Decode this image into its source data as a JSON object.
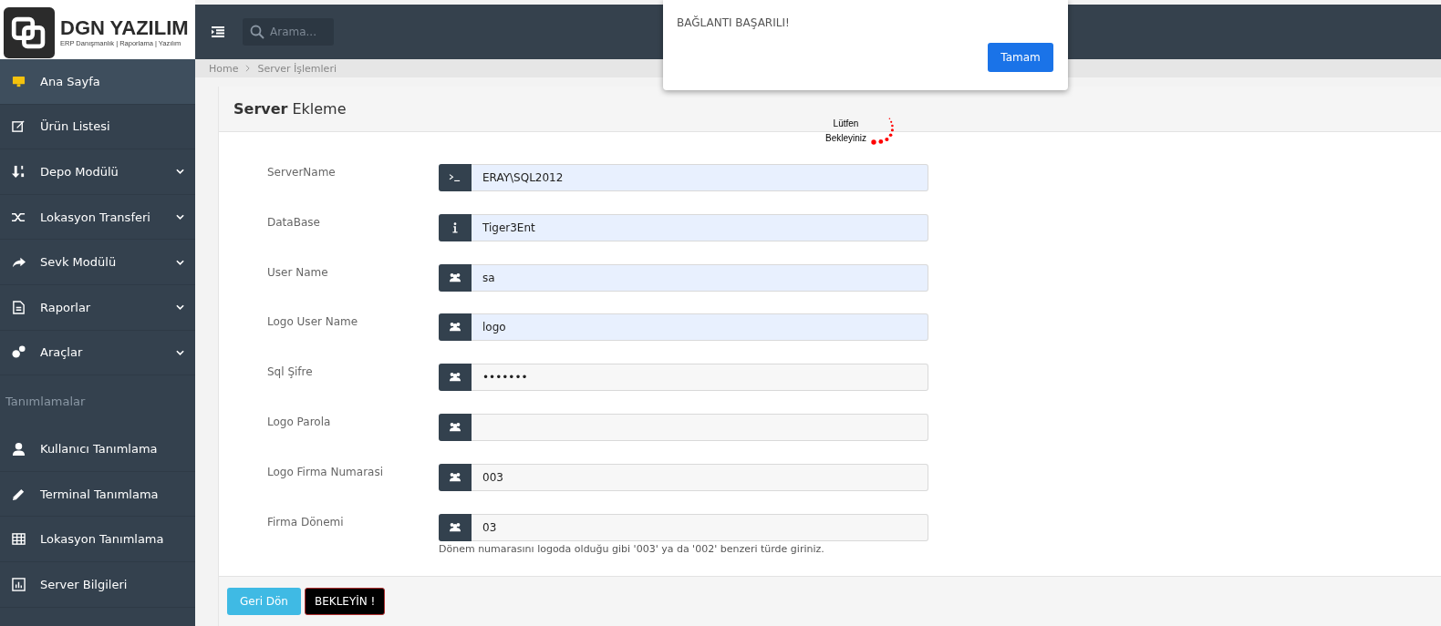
{
  "logo": {
    "title": "DGN YAZILIM",
    "subtitle": "ERP Danışmanlık | Raporlama | Yazılım"
  },
  "search": {
    "placeholder": "Arama..."
  },
  "breadcrumb": [
    "Home",
    "Server İşlemleri"
  ],
  "sidebar": {
    "items": [
      {
        "kind": "item",
        "label": "Ana Sayfa",
        "selected": true,
        "has_submenu": false
      },
      {
        "kind": "item",
        "label": "Ürün Listesi",
        "selected": false,
        "has_submenu": false
      },
      {
        "kind": "item",
        "label": "Depo Modülü",
        "selected": false,
        "has_submenu": true
      },
      {
        "kind": "item",
        "label": "Lokasyon Transferi",
        "selected": false,
        "has_submenu": true
      },
      {
        "kind": "item",
        "label": "Sevk Modülü",
        "selected": false,
        "has_submenu": true
      },
      {
        "kind": "item",
        "label": "Raporlar",
        "selected": false,
        "has_submenu": true
      },
      {
        "kind": "item",
        "label": "Araçlar",
        "selected": false,
        "has_submenu": true
      },
      {
        "kind": "heading",
        "label": "Tanımlamalar"
      },
      {
        "kind": "item",
        "label": "Kullanıcı Tanımlama",
        "selected": false,
        "has_submenu": false
      },
      {
        "kind": "item",
        "label": "Terminal Tanımlama",
        "selected": false,
        "has_submenu": false
      },
      {
        "kind": "item",
        "label": "Lokasyon Tanımlama",
        "selected": false,
        "has_submenu": false
      },
      {
        "kind": "item",
        "label": "Server Bilgileri",
        "selected": false,
        "has_submenu": false
      }
    ]
  },
  "card": {
    "title_bold": "Server",
    "title_rest": "Ekleme"
  },
  "fields": [
    {
      "label": "ServerName",
      "value": "ERAY\\SQL2012",
      "autofilled": true
    },
    {
      "label": "DataBase",
      "value": "Tiger3Ent",
      "autofilled": true
    },
    {
      "label": "User Name",
      "value": "sa",
      "autofilled": true
    },
    {
      "label": "Logo User Name",
      "value": "logo",
      "autofilled": true
    },
    {
      "label": "Sql Şifre",
      "value": "•••••••",
      "autofilled": false
    },
    {
      "label": "Logo Parola",
      "autofilled": false
    },
    {
      "label": "Logo Firma Numarasi",
      "value": "003",
      "autofilled": false
    },
    {
      "label": "Firma Dönemi",
      "value": "03",
      "autofilled": false,
      "help": "Dönem numarasını logoda olduğu gibi '003' ya da '002' benzeri türde giriniz."
    }
  ],
  "buttons": [
    {
      "kind": "back",
      "label": "Geri Dön"
    },
    {
      "kind": "wait",
      "label": "BEKLEYİN !"
    }
  ],
  "spinner": {
    "lines": [
      "Lütfen",
      "Bekleyiniz"
    ]
  },
  "dialog": {
    "message": "BAĞLANTI BAŞARILI!",
    "button": "Tamam"
  }
}
